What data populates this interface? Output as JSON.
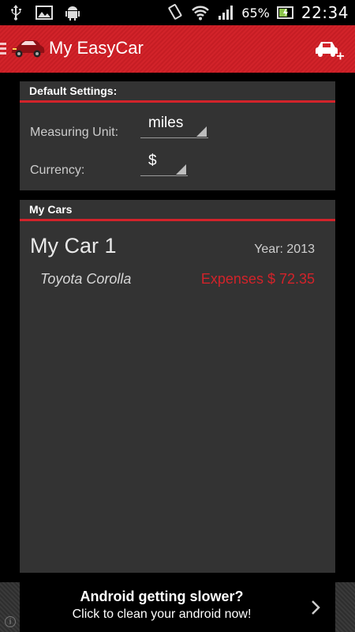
{
  "status_bar": {
    "left_icons": [
      "usb-icon",
      "image-icon",
      "android-icon"
    ],
    "right_icons": [
      "vibrate-icon",
      "wifi-icon",
      "signal-icon"
    ],
    "battery": "65%",
    "time": "22:34"
  },
  "action_bar": {
    "title": "My EasyCar",
    "logo_icon": "car-logo-icon",
    "add_icon": "add-car-icon",
    "color": "#d2232a"
  },
  "settings": {
    "header": "Default Settings:",
    "measuring_unit_label": "Measuring Unit:",
    "measuring_unit_value": "miles",
    "currency_label": "Currency:",
    "currency_value": "$"
  },
  "cars": {
    "header": "My Cars",
    "items": [
      {
        "name": "My Car 1",
        "year": "Year: 2013",
        "model": "Toyota Corolla",
        "expenses": "Expenses $ 72.35"
      }
    ]
  },
  "ad": {
    "title": "Android getting slower?",
    "subtitle": "Click to clean your android now!",
    "info_icon": "info-icon",
    "chevron_icon": "chevron-right-icon"
  }
}
